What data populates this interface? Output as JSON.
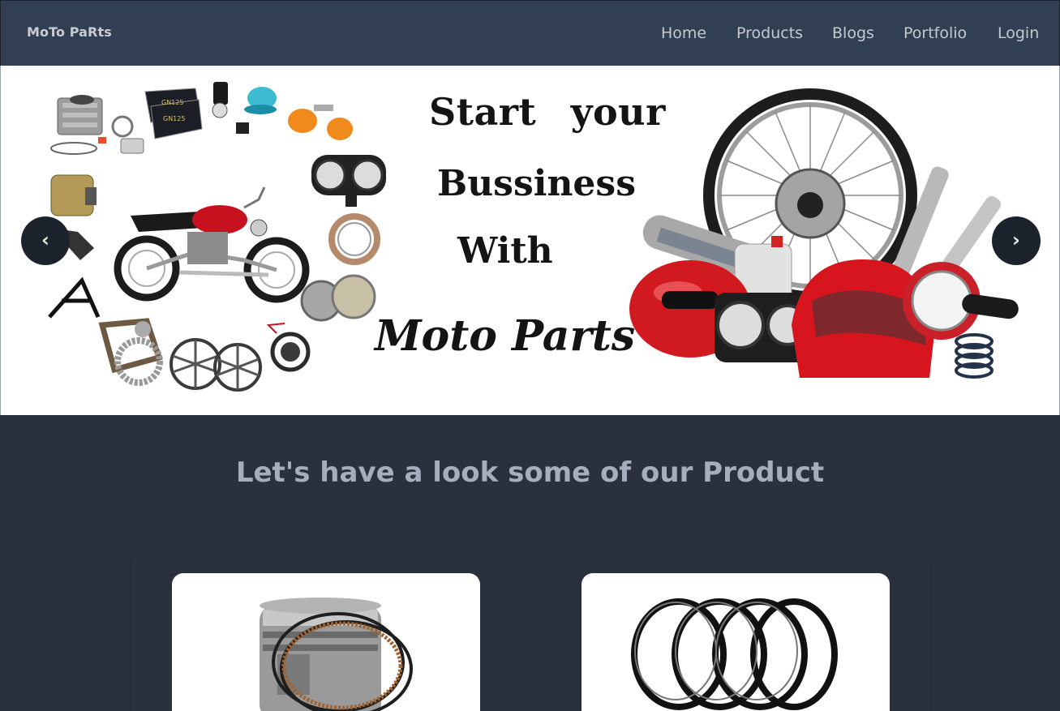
{
  "navbar": {
    "brand": "MoTo PaRts",
    "links": [
      "Home",
      "Products",
      "Blogs",
      "Portfolio",
      "Login"
    ]
  },
  "hero": {
    "headline_line1": "Start your",
    "headline_line2": "Bussiness",
    "headline_line3": "With",
    "headline_line4": "Moto Parts",
    "prev_label": "‹",
    "next_label": "›"
  },
  "products_section": {
    "title": "Let's have a look some of our Product",
    "cards": [
      {
        "image": "piston-with-rings"
      },
      {
        "image": "coil-spring"
      }
    ]
  },
  "colors": {
    "navbar_bg": "#323f52",
    "page_bg": "#2a303c",
    "nav_text": "#c3c9d3",
    "section_title": "#a6adbb",
    "carousel_button": "#1d232d"
  }
}
